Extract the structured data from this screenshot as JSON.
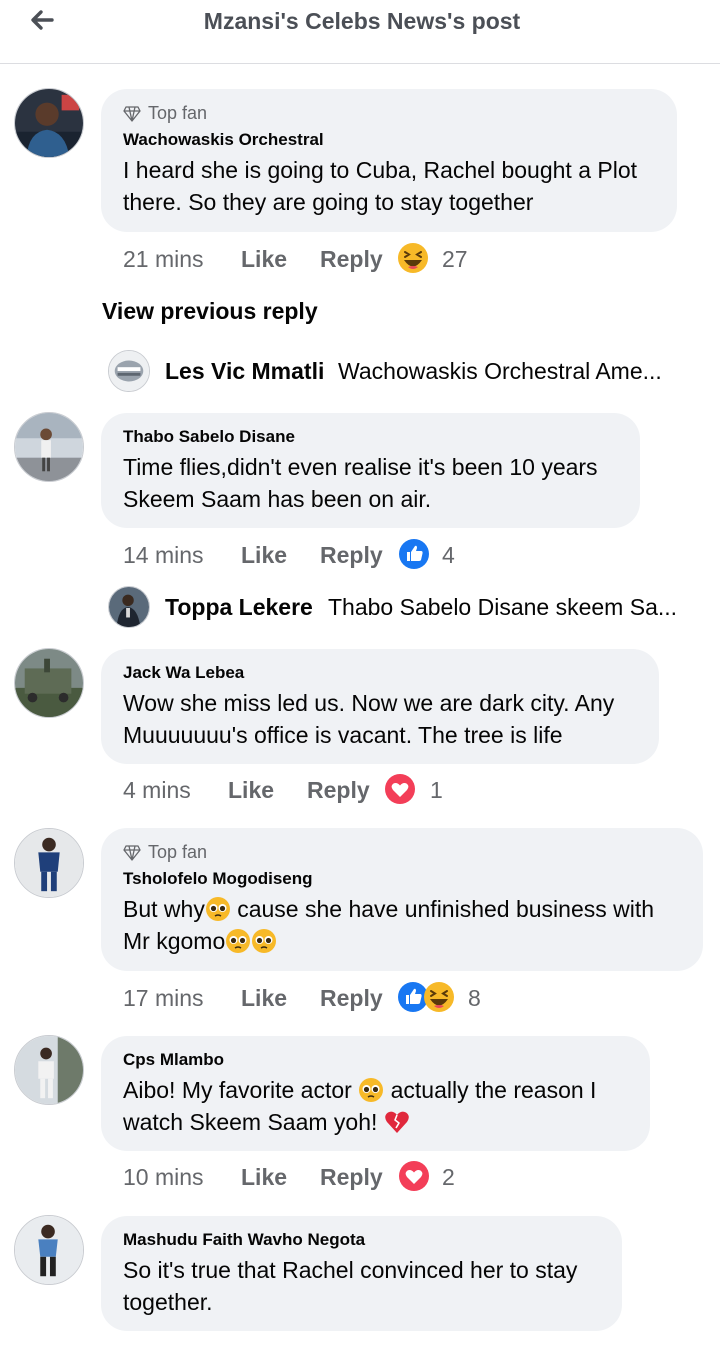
{
  "header": {
    "title": "Mzansi's Celebs News's post"
  },
  "actions": {
    "like": "Like",
    "reply": "Reply"
  },
  "view_previous": "View previous reply",
  "comments": [
    {
      "badge": "Top fan",
      "author": "Wachowaskis Orchestral",
      "text": "I heard she is going to Cuba, Rachel bought a Plot there. So they are going to stay together",
      "time": "21 mins",
      "reactions": [
        "haha"
      ],
      "count": "27"
    },
    {
      "author": "Thabo Sabelo Disane",
      "text": "Time flies,didn't even realise it's been 10 years Skeem Saam has been on air.",
      "time": "14 mins",
      "reactions": [
        "like"
      ],
      "count": "4"
    },
    {
      "author": "Jack Wa Lebea",
      "text": "Wow she miss led us. Now we are dark city. Any Muuuuuuu's  office is vacant. The tree is life",
      "time": "4 mins",
      "reactions": [
        "love"
      ],
      "count": "1"
    },
    {
      "badge": "Top fan",
      "author": "Tsholofelo Mogodiseng",
      "text_a": "But why",
      "text_b": " cause she have unfinished business with Mr kgomo",
      "time": "17 mins",
      "reactions": [
        "like",
        "haha"
      ],
      "count": "8"
    },
    {
      "author": "Cps Mlambo",
      "text_a": "Aibo! My favorite actor ",
      "text_b": " actually the reason I watch Skeem Saam yoh! ",
      "time": "10 mins",
      "reactions": [
        "love"
      ],
      "count": "2"
    },
    {
      "author": "Mashudu Faith Wavho Negota",
      "text": "So it's true that Rachel convinced her to stay together."
    }
  ],
  "replies": [
    {
      "name": "Les Vic Mmatli",
      "text": "Wachowaskis Orchestral Ame..."
    },
    {
      "name": "Toppa Lekere",
      "text": "Thabo Sabelo Disane skeem Sa..."
    }
  ],
  "colors": {
    "bubble": "#f0f2f5",
    "meta": "#65676b",
    "like_blue": "#1877f2",
    "love_red": "#f33e58",
    "haha_yellow": "#f7b928"
  }
}
